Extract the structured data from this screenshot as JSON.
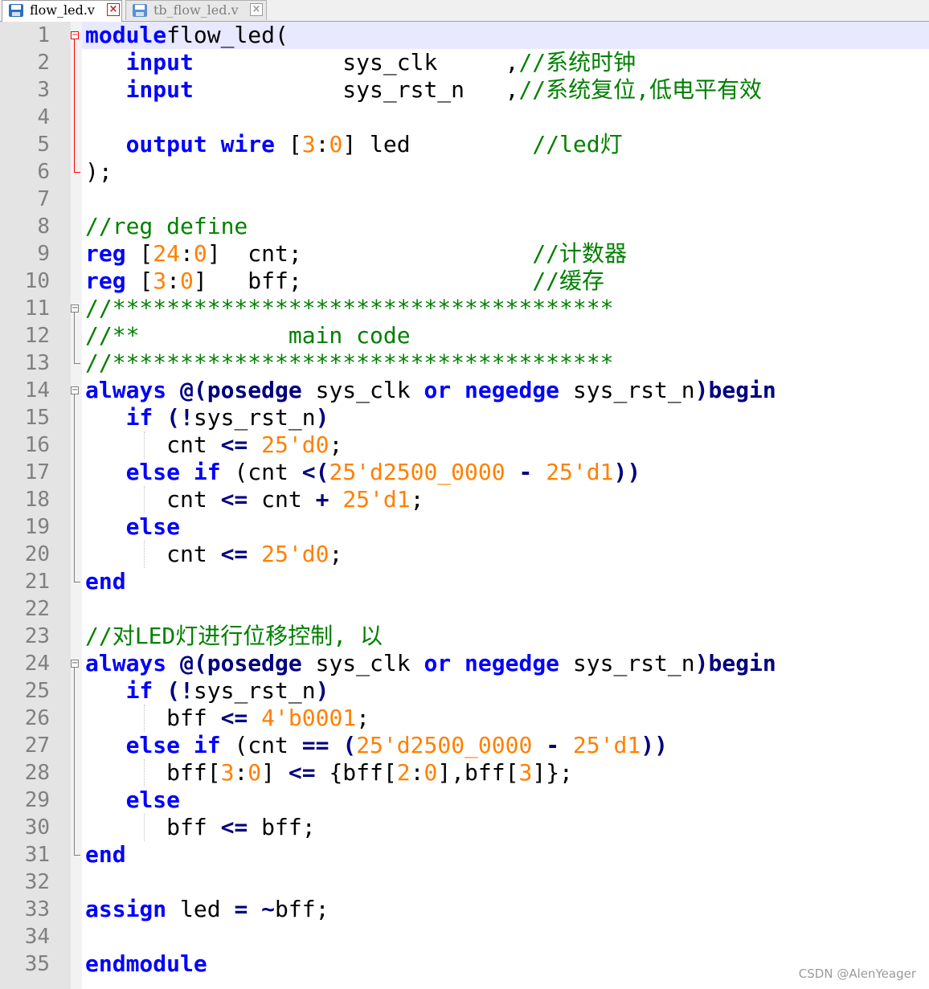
{
  "tabs": [
    {
      "label": "flow_led.v",
      "active": true,
      "icon": "save-icon"
    },
    {
      "label": "tb_flow_led.v",
      "active": false,
      "icon": "save-icon"
    }
  ],
  "editor": {
    "current_line": 1,
    "lines": [
      [
        [
          "kw",
          "module"
        ],
        [
          "",
          "flow_led("
        ]
      ],
      [
        [
          "",
          "   "
        ],
        [
          "kw",
          "input"
        ],
        [
          "",
          "           sys_clk     ,"
        ],
        [
          "cm",
          "//系统时钟"
        ]
      ],
      [
        [
          "",
          "   "
        ],
        [
          "kw",
          "input"
        ],
        [
          "",
          "           sys_rst_n   ,"
        ],
        [
          "cm",
          "//系统复位,低电平有效"
        ]
      ],
      [],
      [
        [
          "",
          "   "
        ],
        [
          "kw",
          "output"
        ],
        [
          "",
          " "
        ],
        [
          "kw",
          "wire"
        ],
        [
          "",
          " ["
        ],
        [
          "nm",
          "3"
        ],
        [
          "",
          ":"
        ],
        [
          "nm",
          "0"
        ],
        [
          "",
          "] led         "
        ],
        [
          "cm",
          "//led灯"
        ]
      ],
      [
        [
          "",
          ");"
        ]
      ],
      [],
      [
        [
          "cm",
          "//reg define"
        ]
      ],
      [
        [
          "kw",
          "reg"
        ],
        [
          "",
          " ["
        ],
        [
          "nm",
          "24"
        ],
        [
          "",
          ":"
        ],
        [
          "nm",
          "0"
        ],
        [
          "",
          "]  cnt;                 "
        ],
        [
          "cm",
          "//计数器"
        ]
      ],
      [
        [
          "kw",
          "reg"
        ],
        [
          "",
          " ["
        ],
        [
          "nm",
          "3"
        ],
        [
          "",
          ":"
        ],
        [
          "nm",
          "0"
        ],
        [
          "",
          "]   bff;                 "
        ],
        [
          "cm",
          "//缓存"
        ]
      ],
      [
        [
          "cm",
          "//*************************************"
        ]
      ],
      [
        [
          "cm",
          "//**           main code"
        ]
      ],
      [
        [
          "cm",
          "//*************************************"
        ]
      ],
      [
        [
          "kw",
          "always"
        ],
        [
          "",
          " "
        ],
        [
          "op",
          "@(posedge"
        ],
        [
          "",
          " sys_clk "
        ],
        [
          "kw",
          "or"
        ],
        [
          "",
          " "
        ],
        [
          "kw",
          "negedge"
        ],
        [
          "",
          " sys_rst_n"
        ],
        [
          "op",
          ")begin"
        ]
      ],
      [
        [
          "",
          "   "
        ],
        [
          "kw",
          "if"
        ],
        [
          "",
          " "
        ],
        [
          "op",
          "(!"
        ],
        [
          "",
          "sys_rst_n"
        ],
        [
          "op",
          ")"
        ]
      ],
      [
        [
          "",
          "      cnt "
        ],
        [
          "op",
          "<="
        ],
        [
          "",
          " "
        ],
        [
          "nm",
          "25'd0"
        ],
        [
          "",
          ";"
        ]
      ],
      [
        [
          "",
          "   "
        ],
        [
          "kw",
          "else if"
        ],
        [
          "",
          " (cnt "
        ],
        [
          "op",
          "<("
        ],
        [
          "nm",
          "25'd2500_0000"
        ],
        [
          "",
          " "
        ],
        [
          "op",
          "-"
        ],
        [
          "",
          " "
        ],
        [
          "nm",
          "25'd1"
        ],
        [
          "op",
          "))"
        ]
      ],
      [
        [
          "",
          "      cnt "
        ],
        [
          "op",
          "<="
        ],
        [
          "",
          " cnt "
        ],
        [
          "op",
          "+"
        ],
        [
          "",
          " "
        ],
        [
          "nm",
          "25'd1"
        ],
        [
          "",
          ";"
        ]
      ],
      [
        [
          "",
          "   "
        ],
        [
          "kw",
          "else"
        ]
      ],
      [
        [
          "",
          "      cnt "
        ],
        [
          "op",
          "<="
        ],
        [
          "",
          " "
        ],
        [
          "nm",
          "25'd0"
        ],
        [
          "",
          ";"
        ]
      ],
      [
        [
          "kw",
          "end"
        ]
      ],
      [],
      [
        [
          "cm",
          "//对LED灯进行位移控制, 以"
        ]
      ],
      [
        [
          "kw",
          "always"
        ],
        [
          "",
          " "
        ],
        [
          "op",
          "@(posedge"
        ],
        [
          "",
          " sys_clk "
        ],
        [
          "kw",
          "or"
        ],
        [
          "",
          " "
        ],
        [
          "kw",
          "negedge"
        ],
        [
          "",
          " sys_rst_n"
        ],
        [
          "op",
          ")begin"
        ]
      ],
      [
        [
          "",
          "   "
        ],
        [
          "kw",
          "if"
        ],
        [
          "",
          " "
        ],
        [
          "op",
          "(!"
        ],
        [
          "",
          "sys_rst_n"
        ],
        [
          "op",
          ")"
        ]
      ],
      [
        [
          "",
          "      bff "
        ],
        [
          "op",
          "<="
        ],
        [
          "",
          " "
        ],
        [
          "nm",
          "4'b0001"
        ],
        [
          "",
          ";"
        ]
      ],
      [
        [
          "",
          "   "
        ],
        [
          "kw",
          "else if"
        ],
        [
          "",
          " (cnt "
        ],
        [
          "op",
          "=="
        ],
        [
          "",
          " "
        ],
        [
          "op",
          "("
        ],
        [
          "nm",
          "25'd2500_0000"
        ],
        [
          "",
          " "
        ],
        [
          "op",
          "-"
        ],
        [
          "",
          " "
        ],
        [
          "nm",
          "25'd1"
        ],
        [
          "op",
          "))"
        ]
      ],
      [
        [
          "",
          "      bff["
        ],
        [
          "nm",
          "3"
        ],
        [
          "",
          ":"
        ],
        [
          "nm",
          "0"
        ],
        [
          "",
          "] "
        ],
        [
          "op",
          "<="
        ],
        [
          "",
          " {bff["
        ],
        [
          "nm",
          "2"
        ],
        [
          "",
          ":"
        ],
        [
          "nm",
          "0"
        ],
        [
          "",
          "],bff["
        ],
        [
          "nm",
          "3"
        ],
        [
          "",
          "]};"
        ]
      ],
      [
        [
          "",
          "   "
        ],
        [
          "kw",
          "else"
        ]
      ],
      [
        [
          "",
          "      bff "
        ],
        [
          "op",
          "<="
        ],
        [
          "",
          " bff;"
        ]
      ],
      [
        [
          "kw",
          "end"
        ]
      ],
      [],
      [
        [
          "kw",
          "assign"
        ],
        [
          "",
          " led "
        ],
        [
          "op",
          "="
        ],
        [
          "",
          " "
        ],
        [
          "op",
          "~"
        ],
        [
          "",
          "bff;"
        ]
      ],
      [],
      [
        [
          "kw",
          "endmodule"
        ]
      ]
    ]
  },
  "watermark": "CSDN @AlenYeager"
}
